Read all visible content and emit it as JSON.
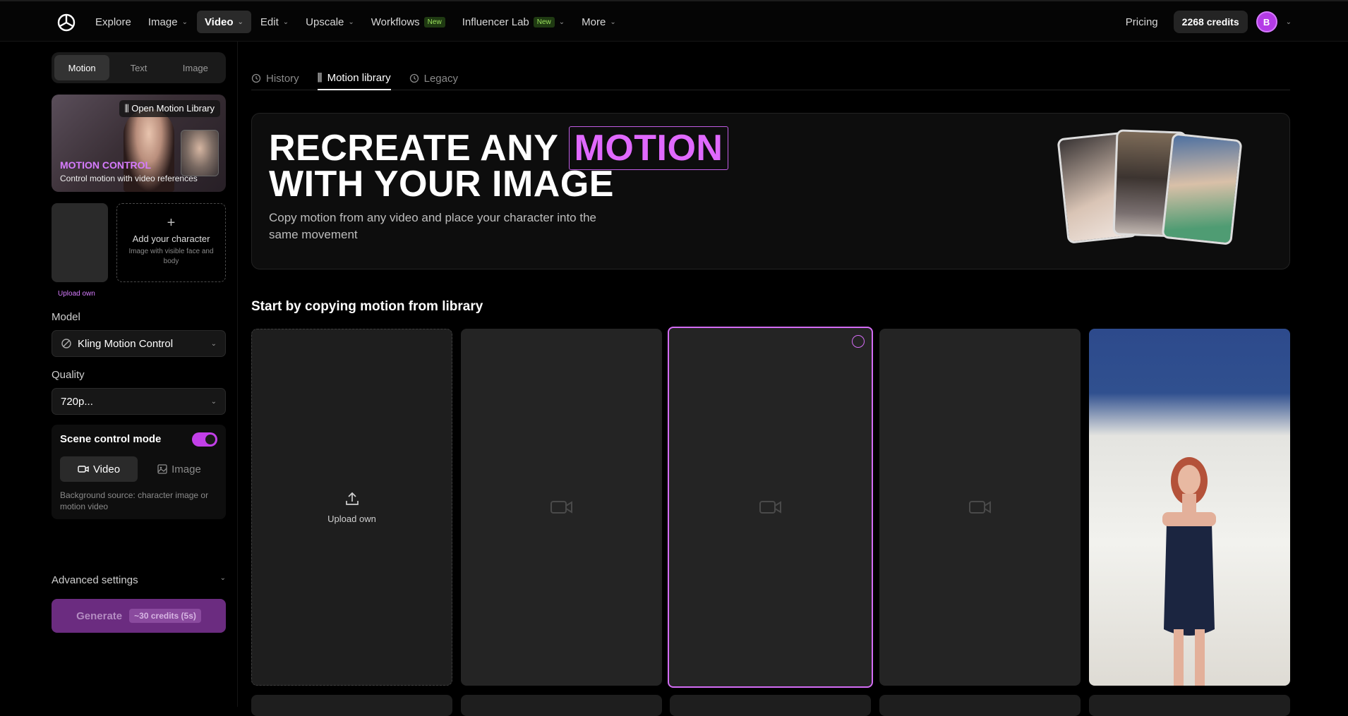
{
  "nav": {
    "items": [
      {
        "label": "Explore",
        "chevron": false
      },
      {
        "label": "Image",
        "chevron": true
      },
      {
        "label": "Video",
        "chevron": true,
        "active": true
      },
      {
        "label": "Edit",
        "chevron": true
      },
      {
        "label": "Upscale",
        "chevron": true
      },
      {
        "label": "Workflows",
        "badge": "New"
      },
      {
        "label": "Influencer Lab",
        "badge": "New",
        "chevron": true
      },
      {
        "label": "More",
        "chevron": true
      }
    ],
    "pricing": "Pricing",
    "credits": "2268 credits",
    "avatar_initial": "B"
  },
  "sidebar": {
    "mode_tabs": [
      "Motion",
      "Text",
      "Image"
    ],
    "motion_card": {
      "open_label": "Open Motion Library",
      "title": "MOTION CONTROL",
      "subtitle": "Control motion with video references"
    },
    "upload_own": "Upload own",
    "add_character": {
      "title": "Add your character",
      "hint": "Image with visible face and body"
    },
    "model_label": "Model",
    "model_value": "Kling Motion Control",
    "quality_label": "Quality",
    "quality_value": "720p...",
    "scene": {
      "title": "Scene control mode",
      "enabled": true,
      "options": [
        "Video",
        "Image"
      ],
      "note": "Background source: character image or motion video"
    },
    "advanced": "Advanced settings",
    "generate": {
      "label": "Generate",
      "cost": "~30 credits (5s)"
    }
  },
  "tabs": [
    "History",
    "Motion library",
    "Legacy"
  ],
  "hero": {
    "line1_prefix": "RECREATE ANY",
    "line1_highlight": "MOTION",
    "line2": "WITH YOUR IMAGE",
    "subtitle": "Copy motion from any video and place your character into the same movement"
  },
  "section_title": "Start by copying motion from library",
  "library": {
    "upload_label": "Upload own"
  },
  "colors": {
    "accent": "#d46cf5",
    "accent_dark": "#6b2c80"
  }
}
